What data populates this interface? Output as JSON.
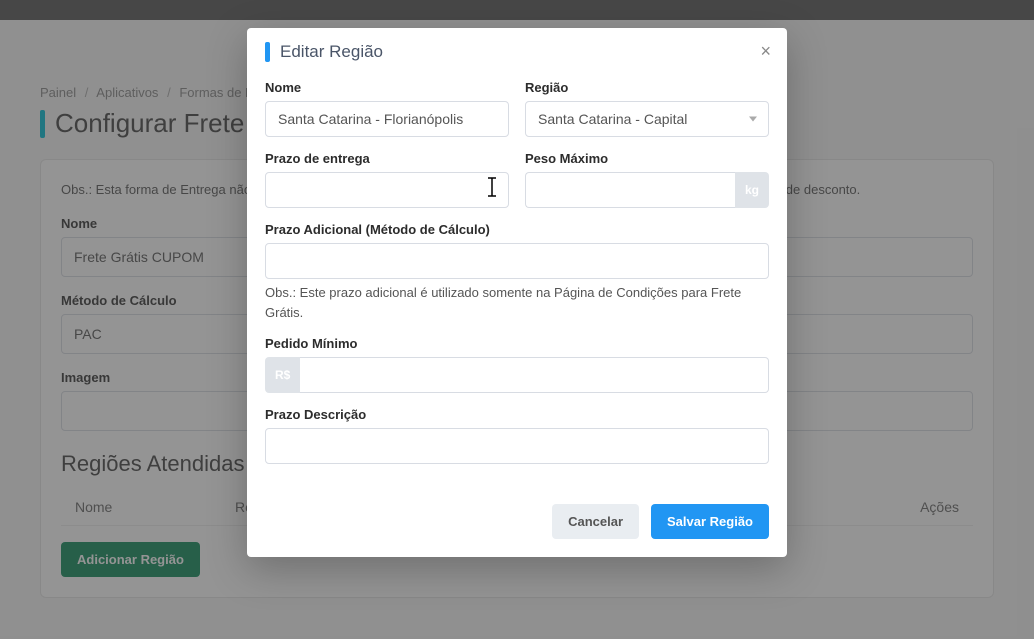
{
  "breadcrumb": {
    "item1": "Painel",
    "item2": "Aplicativos",
    "item3": "Formas de Envio"
  },
  "page": {
    "title": "Configurar Frete"
  },
  "card": {
    "note": "Obs.: Esta forma de Entrega não aparece para o Cliente. Ela é utilizada apenas para configuração de Frete Grátis no Cupom de desconto.",
    "nome_label": "Nome",
    "nome_value": "Frete Grátis CUPOM",
    "metodo_label": "Método de Cálculo",
    "metodo_value": "PAC",
    "imagem_label": "Imagem",
    "section_title": "Regiões Atendidas",
    "col_nome": "Nome",
    "col_regiao": "Região",
    "col_acoes": "Ações",
    "add_button": "Adicionar Região"
  },
  "modal": {
    "title": "Editar Região",
    "nome_label": "Nome",
    "nome_value": "Santa Catarina - Florianópolis",
    "regiao_label": "Região",
    "regiao_value": "Santa Catarina - Capital",
    "prazo_entrega_label": "Prazo de entrega",
    "prazo_entrega_value": "",
    "peso_max_label": "Peso Máximo",
    "peso_max_value": "",
    "peso_suffix": "kg",
    "prazo_adicional_label": "Prazo Adicional (Método de Cálculo)",
    "prazo_adicional_value": "",
    "prazo_adicional_help": "Obs.: Este prazo adicional é utilizado somente na Página de Condições para Frete Grátis.",
    "pedido_min_label": "Pedido Mínimo",
    "pedido_min_prefix": "R$",
    "pedido_min_value": "",
    "prazo_desc_label": "Prazo Descrição",
    "prazo_desc_value": "",
    "cancel": "Cancelar",
    "save": "Salvar Região"
  }
}
